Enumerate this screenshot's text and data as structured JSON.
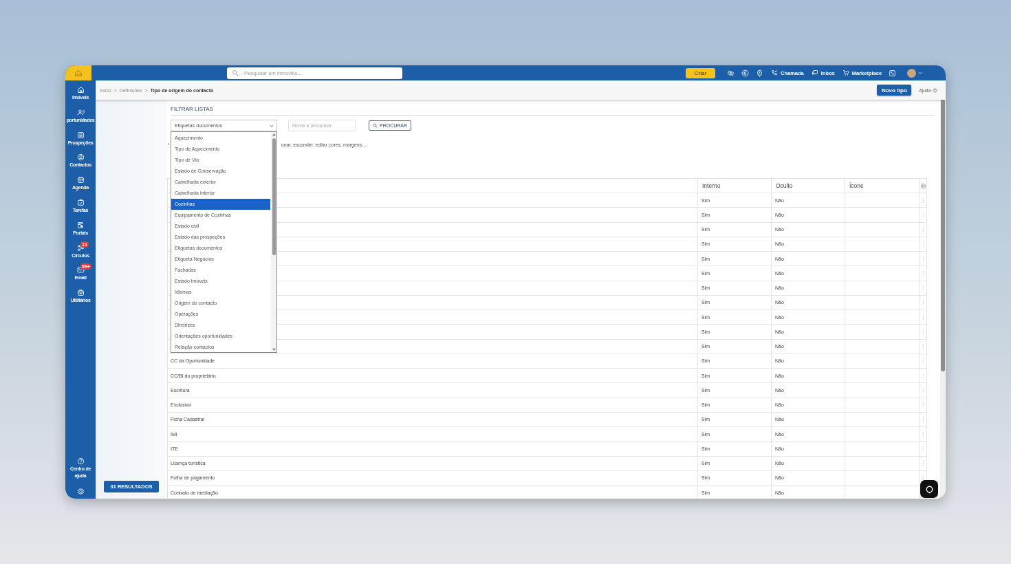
{
  "topbar": {
    "search": {
      "placeholder": "Pesquisar em inmovilla..."
    },
    "create_button": "Criar",
    "tools": [
      {
        "kind": "eye-off"
      },
      {
        "kind": "euro"
      },
      {
        "kind": "phone-badge"
      }
    ],
    "actions": [
      {
        "label": "Chamada",
        "kind": "call"
      },
      {
        "label": "Inbox",
        "kind": "inbox"
      },
      {
        "label": "Marketplace",
        "kind": "cart"
      }
    ]
  },
  "sidebar": {
    "items": [
      {
        "label": "Imóveis",
        "kind": "home"
      },
      {
        "label": "portunidades",
        "kind": "people"
      },
      {
        "label": "Prospeções",
        "kind": "list"
      },
      {
        "label": "Contactos",
        "kind": "contact"
      },
      {
        "label": "Agenda",
        "kind": "calendar"
      },
      {
        "label": "Tarefas",
        "kind": "task"
      },
      {
        "label": "Portais",
        "kind": "portal"
      },
      {
        "label": "Círculos",
        "kind": "circles",
        "badge": "13"
      },
      {
        "label": "Email",
        "kind": "mail",
        "badge": "99+"
      },
      {
        "label": "Utilitários",
        "kind": "tools"
      }
    ],
    "bottom": [
      {
        "label": "Centro de ajuda",
        "kind": "help"
      },
      {
        "kind": "settings"
      }
    ]
  },
  "breadcrumb": {
    "separator": ">",
    "items": [
      {
        "label": "Início",
        "current": false
      },
      {
        "label": "Definições",
        "current": false
      },
      {
        "label": "Tipo de origem do contacto",
        "current": true
      }
    ]
  },
  "new_button": "Novo tipo",
  "help_link": "Ajuda",
  "results_button": "31 RESULTADOS",
  "filter": {
    "title": "FILTRAR LISTAS",
    "select_value": "Etiquetas documentos",
    "search": {
      "placeholder": "Nome a pesquisar"
    },
    "search_button": "PROCURAR",
    "note_prefix": "*",
    "note": "onar, esconder, editar cores, margens..."
  },
  "dropdown": {
    "options": [
      {
        "label": "Aquecimento",
        "selected": false
      },
      {
        "label": "Tipo de Aquecimento",
        "selected": false
      },
      {
        "label": "Tipo de Via",
        "selected": false
      },
      {
        "label": "Estado de Conservação",
        "selected": false
      },
      {
        "label": "Caixelharia exterior",
        "selected": false
      },
      {
        "label": "Caixelharia interior",
        "selected": false
      },
      {
        "label": "Cozinhas",
        "selected": true
      },
      {
        "label": "Equipamento de Cozinhas",
        "selected": false
      },
      {
        "label": "Estado civil",
        "selected": false
      },
      {
        "label": "Estado das prospeções",
        "selected": false
      },
      {
        "label": "Etiquetas documentos",
        "selected": false
      },
      {
        "label": "Etiqueta Negócios",
        "selected": false
      },
      {
        "label": "Fachadas",
        "selected": false
      },
      {
        "label": "Estado Imóveis",
        "selected": false
      },
      {
        "label": "Idiomas",
        "selected": false
      },
      {
        "label": "Origem do contacto",
        "selected": false
      },
      {
        "label": "Operações",
        "selected": false
      },
      {
        "label": "Diretrizes",
        "selected": false
      },
      {
        "label": "Orientações oportunidades",
        "selected": false
      },
      {
        "label": "Relação contactos",
        "selected": false
      }
    ]
  },
  "table": {
    "columns": [
      "Interno",
      "Oculto",
      "Ícone"
    ],
    "rows": [
      {
        "interno": "Sim",
        "oculto": "Não"
      },
      {
        "interno": "Sim",
        "oculto": "Não"
      },
      {
        "interno": "Sim",
        "oculto": "Não"
      },
      {
        "interno": "Sim",
        "oculto": "Não"
      },
      {
        "interno": "Sim",
        "oculto": "Não"
      },
      {
        "interno": "Sim",
        "oculto": "Não"
      },
      {
        "interno": "Sim",
        "oculto": "Não"
      },
      {
        "interno": "Sim",
        "oculto": "Não"
      },
      {
        "interno": "Sim",
        "oculto": "Não"
      },
      {
        "interno": "Sim",
        "oculto": "Não"
      },
      {
        "interno": "Sim",
        "oculto": "Não"
      },
      {
        "name": "CC da Oportunidade",
        "interno": "Sim",
        "oculto": "Não"
      },
      {
        "name": "CC/BI do proprietário",
        "interno": "Sim",
        "oculto": "Não"
      },
      {
        "name": "Escritura",
        "interno": "Sim",
        "oculto": "Não"
      },
      {
        "name": "Exclusiva",
        "interno": "Sim",
        "oculto": "Não"
      },
      {
        "name": "Ficha Cadastral",
        "interno": "Sim",
        "oculto": "Não"
      },
      {
        "name": "IMI",
        "interno": "Sim",
        "oculto": "Não"
      },
      {
        "name": "ITE",
        "interno": "Sim",
        "oculto": "Não"
      },
      {
        "name": "Licença turística",
        "interno": "Sim",
        "oculto": "Não"
      },
      {
        "name": "Folha de pagamento",
        "interno": "Sim",
        "oculto": "Não"
      },
      {
        "name": "Contrato de mediação",
        "interno": "Sim",
        "oculto": "Não"
      }
    ]
  }
}
